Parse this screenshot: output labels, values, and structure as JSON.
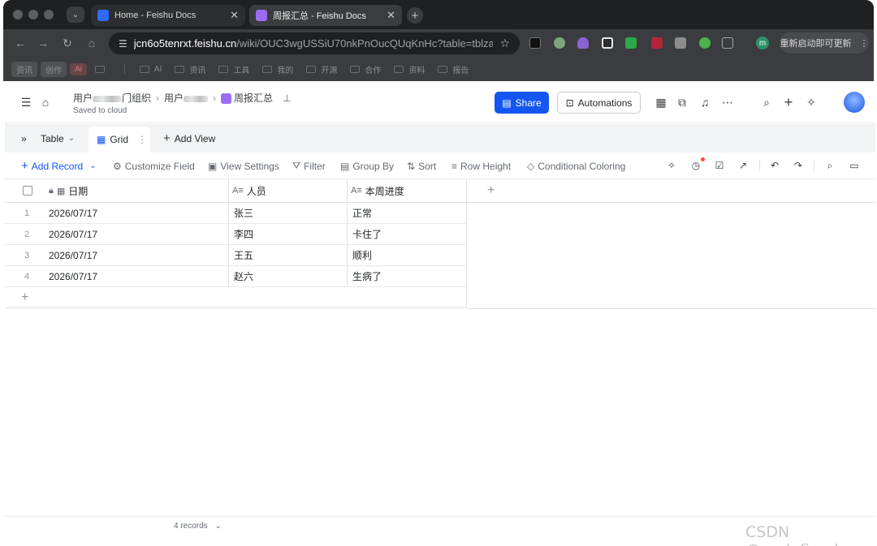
{
  "browser": {
    "tabs": [
      {
        "title": "Home - Feishu Docs",
        "active": false,
        "favicon_color": "#2f6bff"
      },
      {
        "title": "周报汇总 - Feishu Docs",
        "active": true,
        "favicon_color": "#9b6cf5"
      }
    ],
    "url_host": "jcn6o5tenrxt.feishu.cn",
    "url_path": "/wiki/OUC3wgUSSiU70nkPnOucQUqKnHc?table=tblzam...",
    "extension_label_m": "m",
    "update_button": "重新启动即可更新",
    "bookmarks": {
      "tags": [
        "资讯",
        "创作"
      ],
      "ai_tag": "Ai",
      "folders": [
        "AI",
        "资讯",
        "工具",
        "我的",
        "开源",
        "合作",
        "资料",
        "报告"
      ]
    }
  },
  "header": {
    "breadcrumb": {
      "crumb1_prefix": "用户",
      "crumb1_suffix": "门组织",
      "crumb2_prefix": "用户",
      "current": "周报汇总"
    },
    "saved_status": "Saved to cloud",
    "share_label": "Share",
    "automations_label": "Automations"
  },
  "view_bar": {
    "table_label": "Table",
    "grid_label": "Grid",
    "add_view_label": "Add View"
  },
  "toolbar": {
    "add_record": "Add Record",
    "customize_field": "Customize Field",
    "view_settings": "View Settings",
    "filter": "Filter",
    "group_by": "Group By",
    "sort": "Sort",
    "row_height": "Row Height",
    "conditional_coloring": "Conditional Coloring"
  },
  "grid": {
    "columns": [
      "日期",
      "人员",
      "本周进度"
    ],
    "rows": [
      {
        "index": "1",
        "date": "2026/07/17",
        "person": "张三",
        "progress": "正常"
      },
      {
        "index": "2",
        "date": "2026/07/17",
        "person": "李四",
        "progress": "卡住了"
      },
      {
        "index": "3",
        "date": "2026/07/17",
        "person": "王五",
        "progress": "顺利"
      },
      {
        "index": "4",
        "date": "2026/07/17",
        "person": "赵六",
        "progress": "生病了"
      }
    ]
  },
  "footer": {
    "records_label": "4 records",
    "watermark": "CSDN @undefined"
  }
}
